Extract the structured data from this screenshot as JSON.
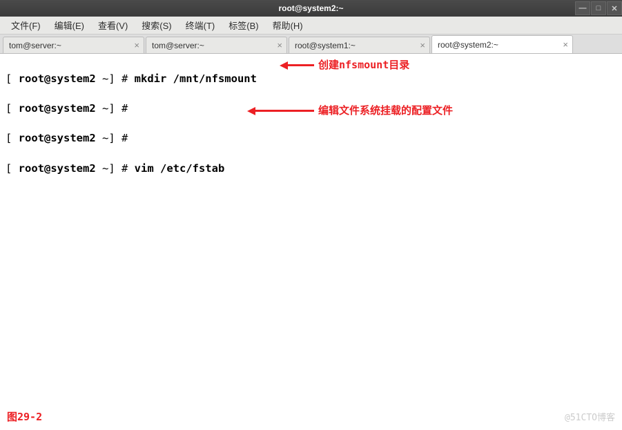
{
  "window": {
    "title": "root@system2:~",
    "controls": {
      "min": "—",
      "max": "□",
      "close": "✕"
    }
  },
  "menu": {
    "file": "文件(F)",
    "edit": "编辑(E)",
    "view": "查看(V)",
    "search": "搜索(S)",
    "terminal": "终端(T)",
    "tabs": "标签(B)",
    "help": "帮助(H)"
  },
  "tabs": [
    {
      "label": "tom@server:~"
    },
    {
      "label": "tom@server:~"
    },
    {
      "label": "root@system1:~"
    },
    {
      "label": "root@system2:~",
      "active": true
    }
  ],
  "terminal": {
    "lines": [
      {
        "prompt_open": "[ ",
        "user_host": "root@system2",
        "path": " ~] # ",
        "cmd": "mkdir /mnt/nfsmount"
      },
      {
        "prompt_open": "[ ",
        "user_host": "root@system2",
        "path": " ~] # ",
        "cmd": ""
      },
      {
        "prompt_open": "[ ",
        "user_host": "root@system2",
        "path": " ~] # ",
        "cmd": ""
      },
      {
        "prompt_open": "[ ",
        "user_host": "root@system2",
        "path": " ~] # ",
        "cmd": "vim /etc/fstab"
      }
    ]
  },
  "annotations": {
    "a1": "创建nfsmount目录",
    "a2": "编辑文件系统挂载的配置文件"
  },
  "caption": "图29-2",
  "watermark": "@51CTO博客"
}
